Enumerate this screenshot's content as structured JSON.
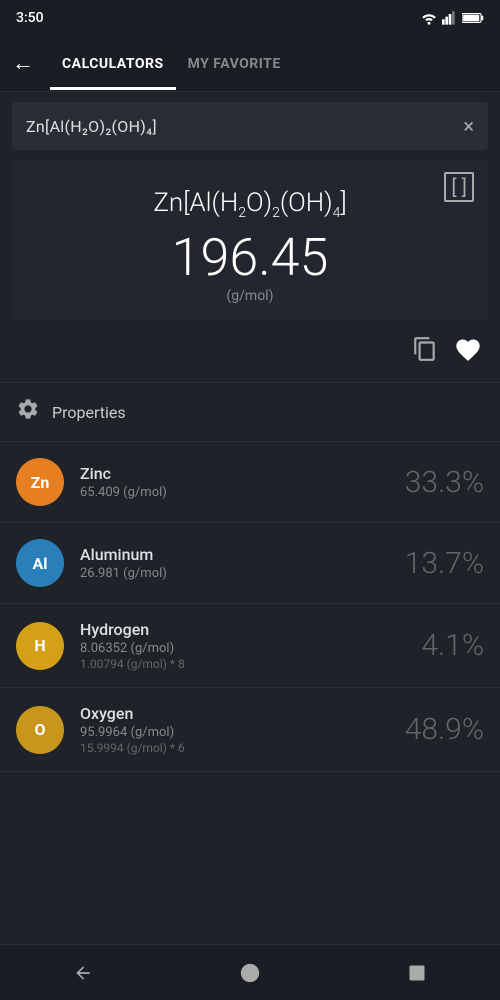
{
  "statusBar": {
    "time": "3:50"
  },
  "tabs": {
    "calculators": "CALCULATORS",
    "myFavorite": "MY FAVORITE"
  },
  "searchBar": {
    "value": "Zn[Al(H₂O)₂(OH)₄]",
    "clearLabel": "×"
  },
  "formula": {
    "display": "Zn[Al(H₂O)₂(OH)₄]",
    "mass": "196.45",
    "unit": "(g/mol)",
    "bracketLabel": "[ ]"
  },
  "actions": {
    "copyLabel": "⧉",
    "favLabel": "♥"
  },
  "properties": {
    "label": "Properties",
    "gearIcon": "⚙"
  },
  "elements": [
    {
      "symbol": "Zn",
      "color": "#e67e22",
      "name": "Zinc",
      "mass": "65.409 (g/mol)",
      "detail": "",
      "percent": "33.3%"
    },
    {
      "symbol": "Al",
      "color": "#2980b9",
      "name": "Aluminum",
      "mass": "26.981 (g/mol)",
      "detail": "",
      "percent": "13.7%"
    },
    {
      "symbol": "H",
      "color": "#d4a017",
      "name": "Hydrogen",
      "mass": "8.06352 (g/mol)",
      "detail": "1.00794 (g/mol) * 8",
      "percent": "4.1%"
    },
    {
      "symbol": "O",
      "color": "#c8961c",
      "name": "Oxygen",
      "mass": "95.9964 (g/mol)",
      "detail": "15.9994 (g/mol) * 6",
      "percent": "48.9%"
    }
  ],
  "bottomNav": {
    "back": "◀",
    "home": "●",
    "recent": "■"
  }
}
